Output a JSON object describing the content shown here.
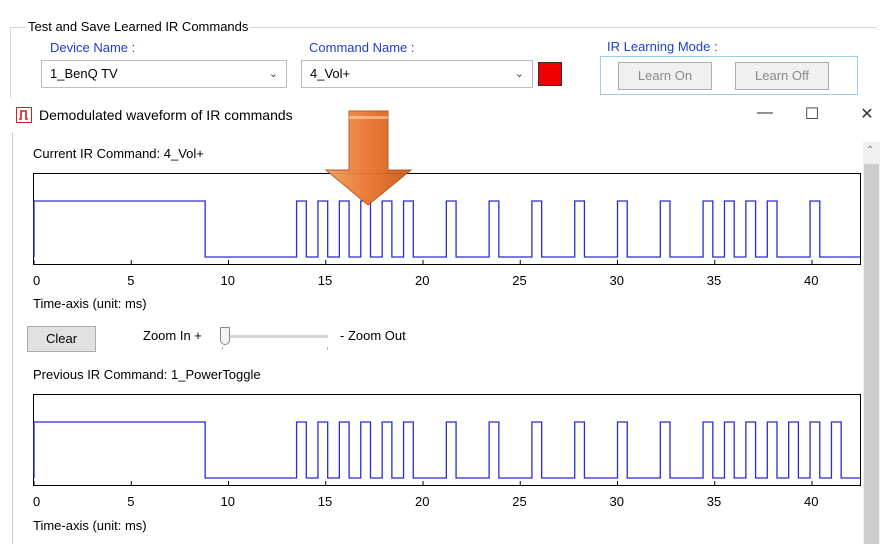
{
  "panel": {
    "group_title": "Test and Save Learned IR Commands",
    "device_label": "Device Name :",
    "device_value": "1_BenQ TV",
    "command_label": "Command Name :",
    "command_value": "4_Vol+",
    "learning_mode_label": "IR Learning Mode :",
    "learn_on": "Learn On",
    "learn_off": "Learn Off",
    "status_color": "#ee0000"
  },
  "window": {
    "title": "Demodulated waveform of IR commands",
    "minimize": "—",
    "maximize": "☐",
    "close": "✕"
  },
  "current": {
    "label": "Current IR Command:  4_Vol+",
    "axis_caption": "Time-axis (unit: ms)"
  },
  "controls": {
    "clear": "Clear",
    "zoom_in": "Zoom In +",
    "zoom_out": "- Zoom Out",
    "zoom_level": 0
  },
  "previous": {
    "label": "Previous IR Command:  1_PowerToggle",
    "axis_caption": "Time-axis (unit: ms)"
  },
  "accent_colors": {
    "waveform": "#2b2bd0",
    "arrow": "#e8742c"
  },
  "chart_data": [
    {
      "type": "line",
      "title": "Current IR Command:  4_Vol+",
      "xlabel": "Time-axis (unit: ms)",
      "ylabel": "",
      "xlim": [
        0,
        42.5
      ],
      "xticks": [
        0,
        5,
        10,
        15,
        20,
        25,
        30,
        35,
        40
      ],
      "levels": [
        0,
        1
      ],
      "initial_level": 1,
      "high_pulses": [
        [
          0,
          8.8
        ],
        [
          13.5,
          14.0
        ],
        [
          14.6,
          15.1
        ],
        [
          15.7,
          16.2
        ],
        [
          16.8,
          17.3
        ],
        [
          17.9,
          18.4
        ],
        [
          19.0,
          19.5
        ],
        [
          21.2,
          21.7
        ],
        [
          23.4,
          23.9
        ],
        [
          25.6,
          26.1
        ],
        [
          27.8,
          28.3
        ],
        [
          30.0,
          30.5
        ],
        [
          32.2,
          32.7
        ],
        [
          34.4,
          34.9
        ],
        [
          35.5,
          36.0
        ],
        [
          36.6,
          37.1
        ],
        [
          37.7,
          38.2
        ],
        [
          39.9,
          40.4
        ]
      ]
    },
    {
      "type": "line",
      "title": "Previous IR Command:  1_PowerToggle",
      "xlabel": "Time-axis (unit: ms)",
      "ylabel": "",
      "xlim": [
        0,
        42.5
      ],
      "xticks": [
        0,
        5,
        10,
        15,
        20,
        25,
        30,
        35,
        40
      ],
      "levels": [
        0,
        1
      ],
      "initial_level": 1,
      "high_pulses": [
        [
          0,
          8.8
        ],
        [
          13.5,
          14.0
        ],
        [
          14.6,
          15.1
        ],
        [
          15.7,
          16.2
        ],
        [
          16.8,
          17.3
        ],
        [
          17.9,
          18.4
        ],
        [
          19.0,
          19.5
        ],
        [
          21.2,
          21.7
        ],
        [
          23.4,
          23.9
        ],
        [
          25.6,
          26.1
        ],
        [
          27.8,
          28.3
        ],
        [
          30.0,
          30.5
        ],
        [
          32.2,
          32.7
        ],
        [
          34.4,
          34.9
        ],
        [
          35.5,
          36.0
        ],
        [
          36.6,
          37.1
        ],
        [
          37.7,
          38.2
        ],
        [
          38.8,
          39.3
        ],
        [
          39.9,
          40.4
        ],
        [
          41.0,
          41.5
        ]
      ]
    }
  ]
}
